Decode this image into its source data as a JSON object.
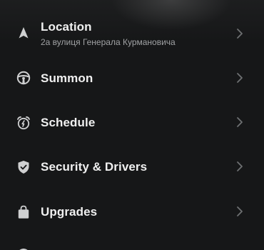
{
  "menu": {
    "location": {
      "label": "Location",
      "address": "2а вулиця Генерала Курмановича"
    },
    "summon": {
      "label": "Summon"
    },
    "schedule": {
      "label": "Schedule"
    },
    "security": {
      "label": "Security & Drivers"
    },
    "upgrades": {
      "label": "Upgrades"
    }
  },
  "colors": {
    "background": "#161718",
    "text": "#f0f0f0",
    "subtext": "#a0a2a4",
    "icon": "#cfd0d1",
    "chevron": "#6e7072"
  },
  "icons": {
    "location": "navigation-arrow-icon",
    "summon": "steering-wheel-icon",
    "schedule": "alarm-clock-icon",
    "security": "shield-check-icon",
    "upgrades": "shopping-bag-icon",
    "chevron": "chevron-right-icon"
  }
}
